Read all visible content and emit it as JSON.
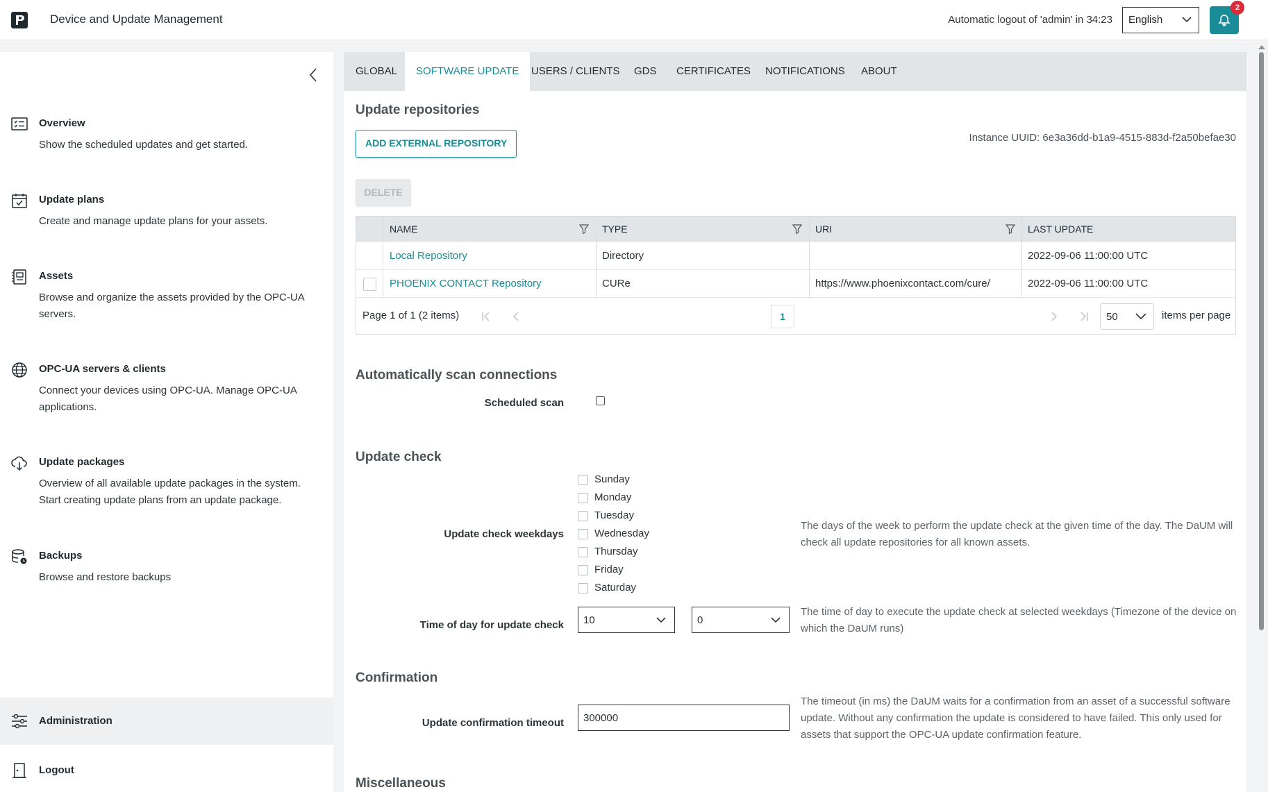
{
  "header": {
    "app_title": "Device and Update Management",
    "logout_info": "Automatic logout of 'admin' in 34:23",
    "language": "English",
    "notification_count": "2"
  },
  "sidebar": {
    "items": [
      {
        "title": "Overview",
        "desc": "Show the scheduled updates and get started.",
        "icon": "list-icon"
      },
      {
        "title": "Update plans",
        "desc": "Create and manage update plans for your assets.",
        "icon": "calendar-check-icon"
      },
      {
        "title": "Assets",
        "desc": "Browse and organize the assets provided by the OPC-UA servers.",
        "icon": "device-icon"
      },
      {
        "title": "OPC-UA servers & clients",
        "desc": "Connect your devices using OPC-UA. Manage OPC-UA applications.",
        "icon": "globe-icon"
      },
      {
        "title": "Update packages",
        "desc": "Overview of all available update packages in the system. Start creating update plans from an update package.",
        "icon": "cloud-download-icon"
      },
      {
        "title": "Backups",
        "desc": "Browse and restore backups",
        "icon": "database-icon"
      }
    ],
    "administration": "Administration",
    "logout": "Logout"
  },
  "tabs": [
    "GLOBAL",
    "SOFTWARE UPDATE",
    "USERS / CLIENTS",
    "GDS",
    "CERTIFICATES",
    "NOTIFICATIONS",
    "ABOUT"
  ],
  "active_tab": "SOFTWARE UPDATE",
  "repositories": {
    "title": "Update repositories",
    "add_button": "ADD EXTERNAL REPOSITORY",
    "uuid": "Instance UUID: 6e3a36dd-b1a9-4515-883d-f2a50befae30",
    "delete_button": "DELETE",
    "columns": [
      "NAME",
      "TYPE",
      "URI",
      "LAST UPDATE"
    ],
    "rows": [
      {
        "name": "Local Repository",
        "type": "Directory",
        "uri": "",
        "last_update": "2022-09-06 11:00:00 UTC"
      },
      {
        "name": "PHOENIX CONTACT Repository",
        "type": "CURe",
        "uri": "https://www.phoenixcontact.com/cure/",
        "last_update": "2022-09-06 11:00:00 UTC"
      }
    ],
    "pager_info": "Page 1 of 1 (2 items)",
    "current_page": "1",
    "page_size": "50",
    "items_per_page": "items per page"
  },
  "scan": {
    "title": "Automatically scan connections",
    "scheduled_scan_label": "Scheduled scan"
  },
  "update_check": {
    "title": "Update check",
    "weekdays_label": "Update check weekdays",
    "weekdays": [
      "Sunday",
      "Monday",
      "Tuesday",
      "Wednesday",
      "Thursday",
      "Friday",
      "Saturday"
    ],
    "weekdays_help": "The days of the week to perform the update check at the given time of the day. The DaUM will check all update repositories for all known assets.",
    "time_label": "Time of day for update check",
    "hour": "10",
    "minute": "0",
    "time_help": "The time of day to execute the update check at selected weekdays (Timezone of the device on which the DaUM runs)"
  },
  "confirmation": {
    "title": "Confirmation",
    "timeout_label": "Update confirmation timeout",
    "timeout_value": "300000",
    "timeout_help": "The timeout (in ms) the DaUM waits for a confirmation from an asset of a successful software update. Without any confirmation the update is considered to have failed. This only used for assets that support the OPC-UA update confirmation feature."
  },
  "misc": {
    "title": "Miscellaneous"
  },
  "colors": {
    "accent": "#1a8c97",
    "badge": "#d92b3a"
  }
}
